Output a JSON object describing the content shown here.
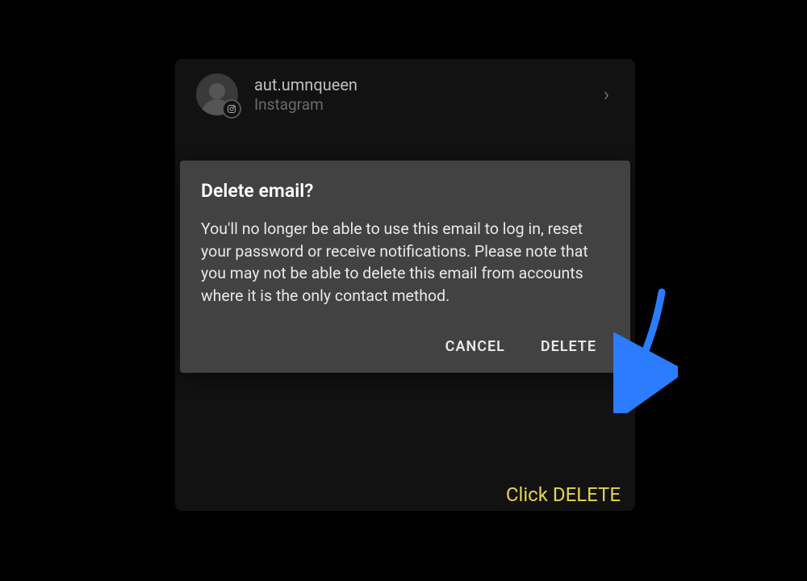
{
  "account": {
    "username": "aut.umnqueen",
    "platform": "Instagram"
  },
  "dialog": {
    "title": "Delete email?",
    "body": "You'll no longer be able to use this email to log in, reset your password or receive notifications. Please note that you may not be able to delete this email from accounts where it is the only contact method.",
    "cancel_label": "CANCEL",
    "delete_label": "DELETE"
  },
  "annotation": {
    "text": "Click DELETE"
  }
}
